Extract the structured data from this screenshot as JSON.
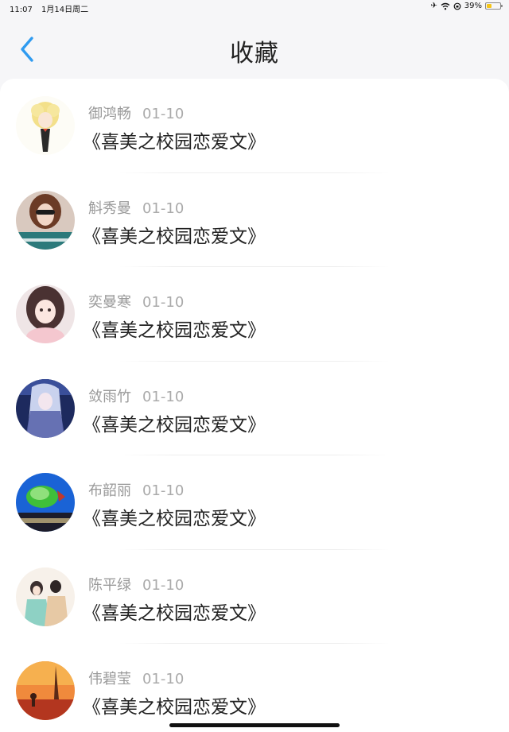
{
  "status_bar": {
    "time": "11:07",
    "date": "1月14日周二",
    "battery": "39%",
    "battery_level": 0.39,
    "icons": [
      "airplane-icon",
      "wifi-icon",
      "orientation-lock-icon"
    ]
  },
  "header": {
    "back_icon": "chevron-left-icon",
    "title": "收藏"
  },
  "items": [
    {
      "name": "御鸿畅",
      "date": "01-10",
      "title": "《喜美之校园恋爱文》"
    },
    {
      "name": "斛秀曼",
      "date": "01-10",
      "title": "《喜美之校园恋爱文》"
    },
    {
      "name": "奕曼寒",
      "date": "01-10",
      "title": "《喜美之校园恋爱文》"
    },
    {
      "name": "敛雨竹",
      "date": "01-10",
      "title": "《喜美之校园恋爱文》"
    },
    {
      "name": "布韶丽",
      "date": "01-10",
      "title": "《喜美之校园恋爱文》"
    },
    {
      "name": "陈平绿",
      "date": "01-10",
      "title": "《喜美之校园恋爱文》"
    },
    {
      "name": "伟碧莹",
      "date": "01-10",
      "title": "《喜美之校园恋爱文》"
    }
  ],
  "colors": {
    "accent": "#2f9bf0",
    "title_text": "#222222",
    "meta_text": "#999999"
  }
}
